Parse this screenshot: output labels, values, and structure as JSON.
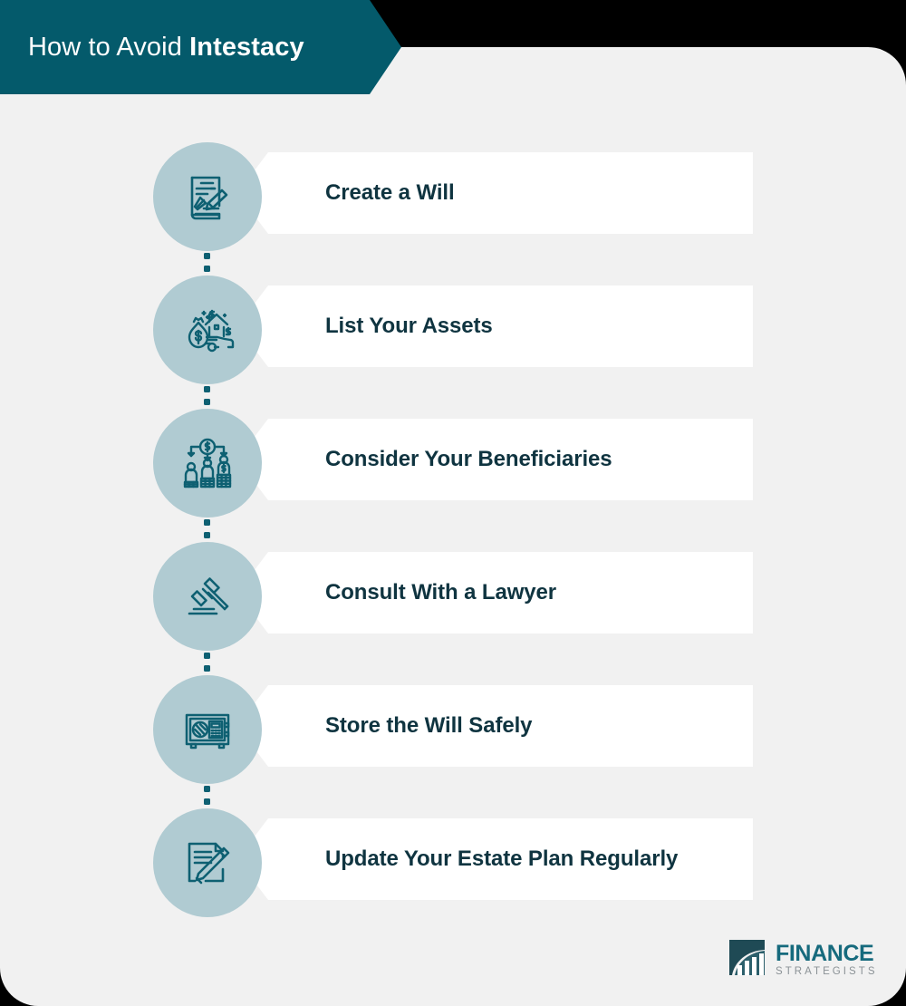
{
  "header": {
    "title_plain": "How to Avoid ",
    "title_bold": "Intestacy",
    "background_color": "#045a6b"
  },
  "theme": {
    "page_background": "#f1f1f1",
    "circle_fill": "#b0cbd2",
    "icon_stroke": "#0e6072",
    "card_background": "#ffffff",
    "card_text_color": "#0f3440",
    "connector_dot_color": "#0e6072"
  },
  "steps": [
    {
      "label": "Create a Will",
      "icon": "document-signature-icon"
    },
    {
      "label": "List Your Assets",
      "icon": "assets-money-house-car-icon"
    },
    {
      "label": "Consider Your Beneficiaries",
      "icon": "beneficiaries-distribution-icon"
    },
    {
      "label": "Consult With a Lawyer",
      "icon": "gavel-icon"
    },
    {
      "label": "Store the Will Safely",
      "icon": "safe-vault-icon"
    },
    {
      "label": "Update Your Estate Plan Regularly",
      "icon": "document-pencil-icon"
    }
  ],
  "logo": {
    "primary_text": "FINANCE",
    "secondary_text": "STRATEGISTS",
    "primary_color": "#166a7d",
    "secondary_color": "#8b9296",
    "mark": "finance-strategists-bars-icon"
  }
}
